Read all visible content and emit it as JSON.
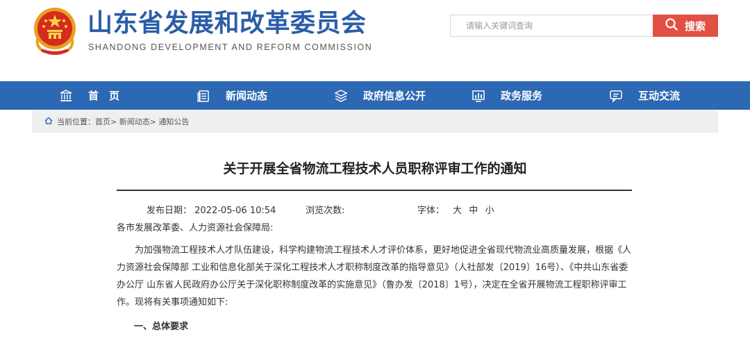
{
  "header": {
    "title": "山东省发展和改革委员会",
    "subtitle": "SHANDONG DEVELOPMENT AND REFORM COMMISSION",
    "search_placeholder": "请输入关键词查询",
    "search_button": "搜索"
  },
  "nav": {
    "items": [
      {
        "label": "首　页",
        "icon": "building-icon"
      },
      {
        "label": "新闻动态",
        "icon": "document-icon"
      },
      {
        "label": "政府信息公开",
        "icon": "layers-icon"
      },
      {
        "label": "政务服务",
        "icon": "chart-icon"
      },
      {
        "label": "互动交流",
        "icon": "chat-icon"
      }
    ]
  },
  "breadcrumb": {
    "prefix": "当前位置：",
    "items": [
      "首页",
      "新闻动态",
      "通知公告"
    ]
  },
  "article": {
    "title": "关于开展全省物流工程技术人员职称评审工作的通知",
    "publish_label": "发布日期：",
    "publish_date": "2022-05-06 10:54",
    "views_label": "浏览次数:",
    "font_label": "字体：",
    "font_sizes": [
      "大",
      "中",
      "小"
    ],
    "salutation": "各市发展改革委、人力资源社会保障局:",
    "paragraph1": "为加强物流工程技术人才队伍建设，科学构建物流工程技术人才评价体系，更好地促进全省现代物流业高质量发展，根据《人力资源社会保障部 工业和信息化部关于深化工程技术人才职称制度改革的指导意见》（人社部发〔2019〕16号）、《中共山东省委办公厅 山东省人民政府办公厅关于深化职称制度改革的实施意见》（鲁办发〔2018〕1号），决定在全省开展物流工程职称评审工作。现将有关事项通知如下:",
    "section1": "一、总体要求"
  },
  "colors": {
    "brand_blue": "#2a5da8",
    "nav_blue": "#2c68b3",
    "search_red": "#e25044"
  }
}
